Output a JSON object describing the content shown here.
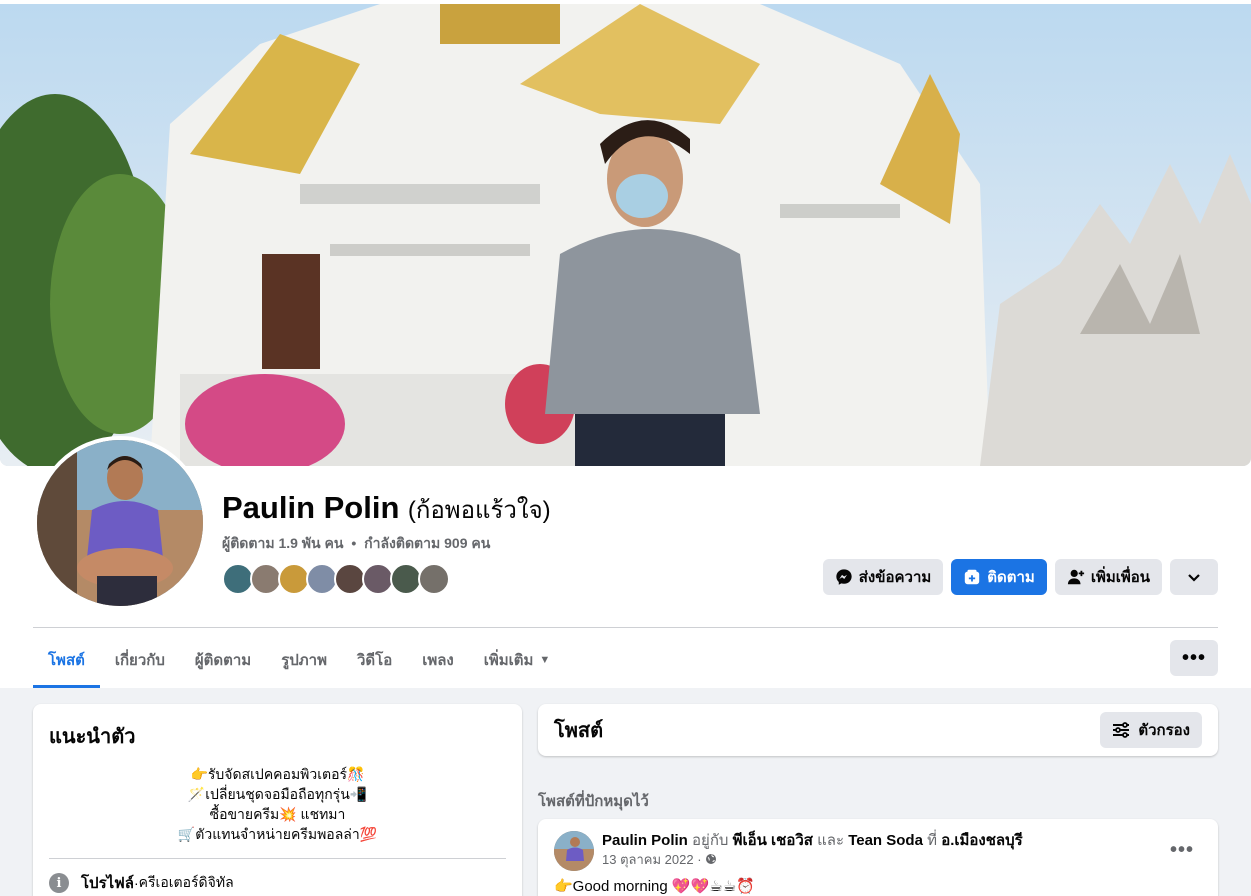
{
  "profile": {
    "name": "Paulin Polin",
    "alt_name": "(ก้อพอแร้วใจ)",
    "followers": "ผู้ติดตาม 1.9 พัน คน",
    "stats_separator": "•",
    "following": "กำลังติดตาม 909 คน"
  },
  "actions": {
    "message_label": "ส่งข้อความ",
    "follow_label": "ติดตาม",
    "add_friend_label": "เพิ่มเพื่อน"
  },
  "tabs": {
    "posts": "โพสต์",
    "about": "เกี่ยวกับ",
    "followers": "ผู้ติดตาม",
    "photos": "รูปภาพ",
    "videos": "วิดีโอ",
    "music": "เพลง",
    "more": "เพิ่มเติม"
  },
  "intro": {
    "title": "แนะนำตัว",
    "bio": [
      "👉รับจัดสเปคคอมพิวเตอร์🎊",
      "🪄เปลี่ยนชุดจอมือถือทุกรุ่น📲",
      "ซื้อขายครีม💥 แชทมา",
      "🛒ตัวแทนจำหน่ายครีมพอลล่า💯"
    ],
    "profile_label": "โปรไฟล์",
    "profile_sep": " · ",
    "profile_category": "ครีเอเตอร์ดิจิทัล"
  },
  "posts_section": {
    "title": "โพสต์",
    "filter_label": "ตัวกรอง",
    "pinned_label": "โพสต์ที่ปักหมุดไว้"
  },
  "post": {
    "author": "Paulin Polin",
    "with_word": "อยู่กับ",
    "tagged1": "พีเอ็น เชอวิส",
    "and_word": "และ",
    "tagged2": "Tean Soda",
    "at_word": "ที่",
    "location": "อ.เมืองชลบุรี",
    "date": "13 ตุลาคม 2022 ·",
    "text": "👉Good morning 💖💖☕☕⏰"
  },
  "colors": {
    "accent": "#1b74e4",
    "secondary_text": "#65676b",
    "button_gray": "#e4e6eb"
  }
}
